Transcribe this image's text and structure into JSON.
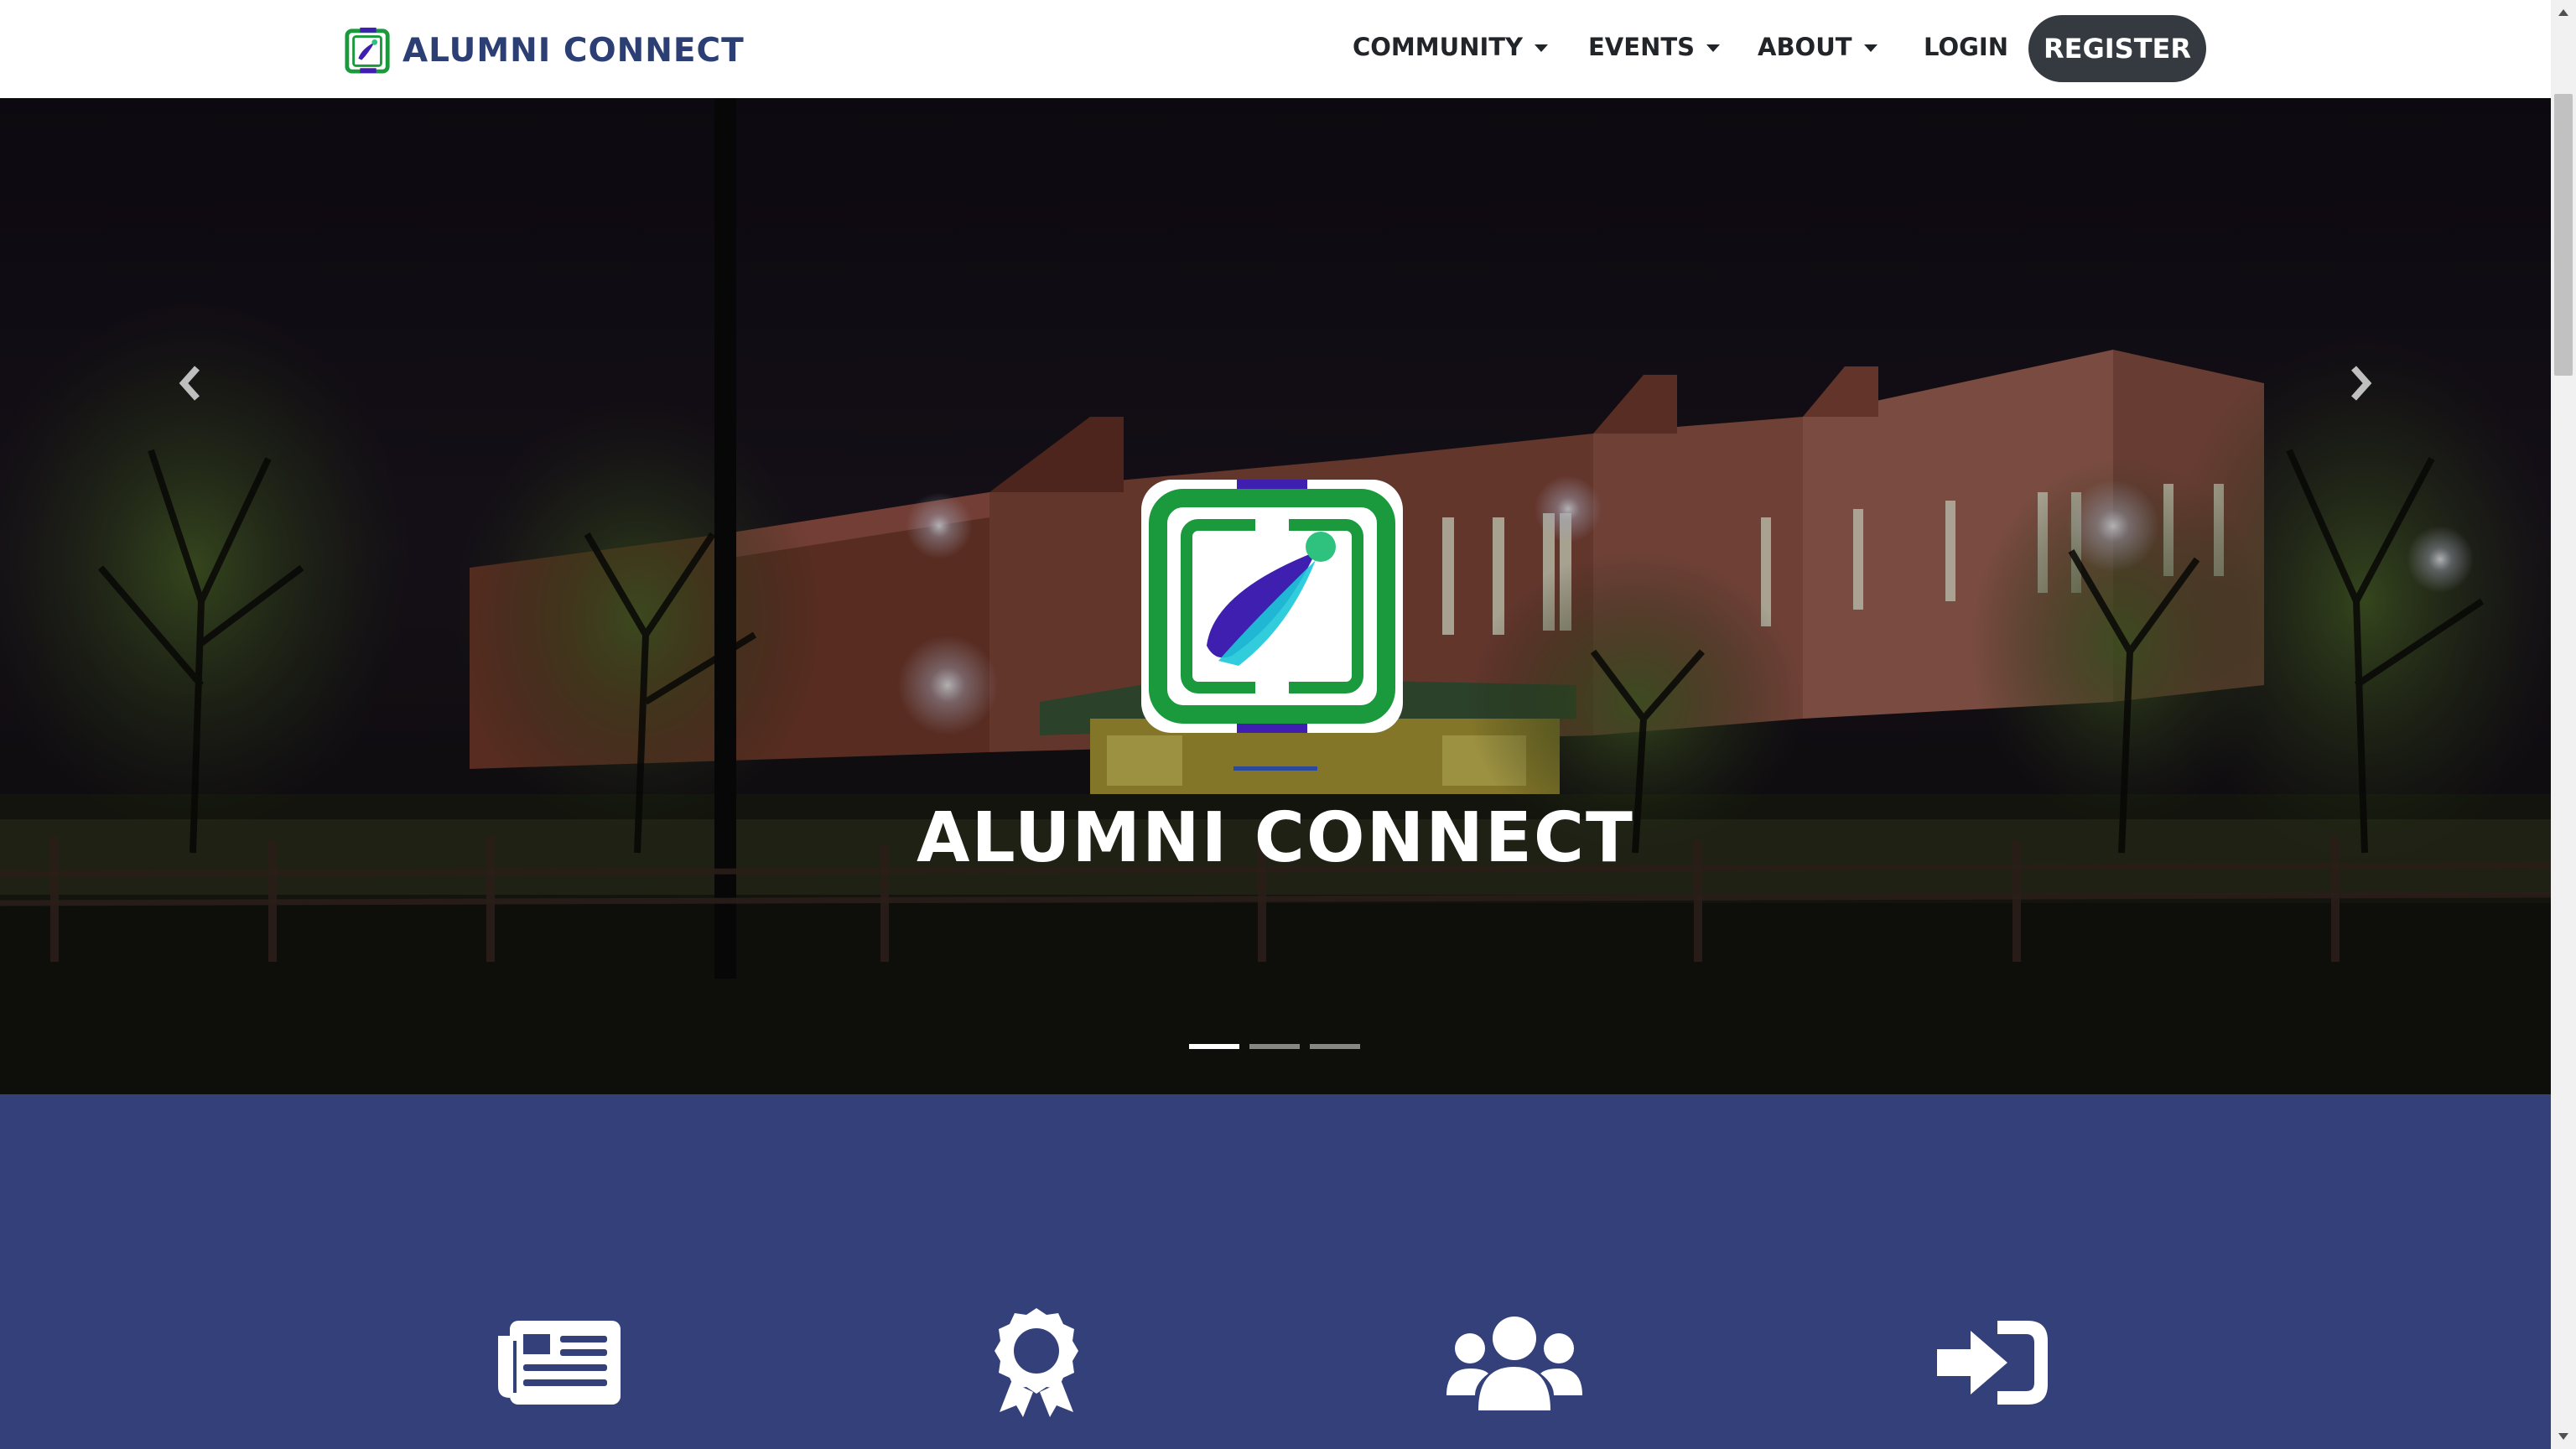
{
  "navbar": {
    "brand": "ALUMNI CONNECT",
    "brand_icon": "alumni-connect-logo",
    "items": [
      {
        "label": "COMMUNITY",
        "has_dropdown": true
      },
      {
        "label": "EVENTS",
        "has_dropdown": true
      },
      {
        "label": "ABOUT",
        "has_dropdown": true
      },
      {
        "label": "LOGIN",
        "has_dropdown": false
      }
    ],
    "register_label": "REGISTER"
  },
  "hero": {
    "title": "ALUMNI CONNECT",
    "logo_icon": "alumni-connect-logo",
    "prev_icon": "chevron-left-icon",
    "next_icon": "chevron-right-icon",
    "slide_count": 3,
    "active_slide": 1
  },
  "features": {
    "icons": [
      "newspaper-icon",
      "award-icon",
      "users-icon",
      "sign-in-icon"
    ]
  },
  "colors": {
    "brand_blue": "#2c3f75",
    "band_blue": "#33407a",
    "register_bg": "#343a40",
    "logo_green": "#1a9a3c",
    "logo_purple": "#3f1fb0"
  }
}
